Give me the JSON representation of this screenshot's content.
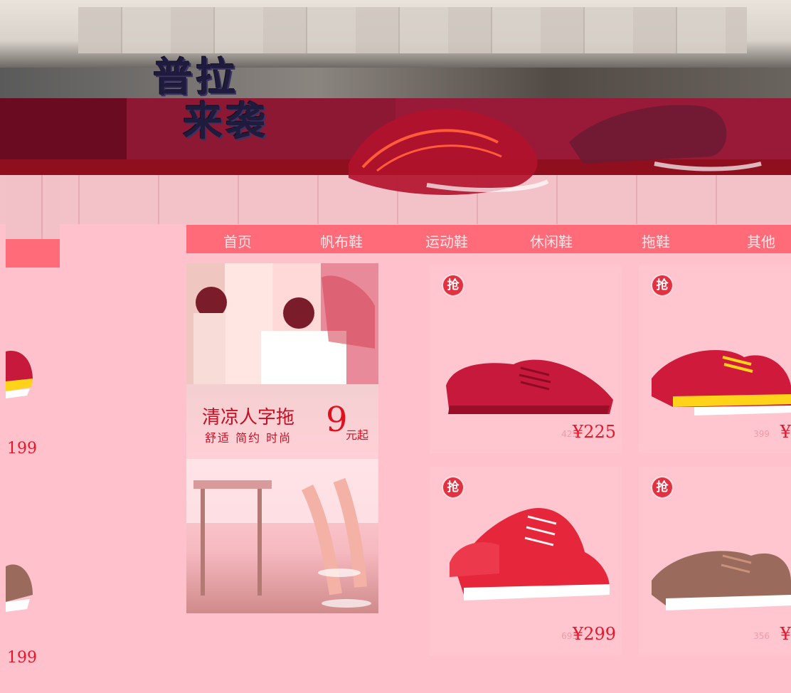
{
  "hero": {
    "title_line1": "普拉",
    "title_line2": "来袭"
  },
  "nav": {
    "items": [
      {
        "label": "首页"
      },
      {
        "label": "帆布鞋"
      },
      {
        "label": "运动鞋"
      },
      {
        "label": "休闲鞋"
      },
      {
        "label": "拖鞋"
      },
      {
        "label": "其他"
      }
    ]
  },
  "promo": {
    "title": "清凉人字拖",
    "subtitle": "舒适 简约 时尚",
    "price_number": "9",
    "price_unit": "元起"
  },
  "left_strip": {
    "prices": [
      "199",
      "199"
    ]
  },
  "products": [
    {
      "badge": "抢",
      "old_price": "425",
      "price": "¥225",
      "shoe_color": "#c7193c",
      "shoe_type": "casual-loafer"
    },
    {
      "badge": "抢",
      "old_price": "399",
      "price": "¥",
      "shoe_color": "#d01a3c",
      "shoe_type": "sport-runner"
    },
    {
      "badge": "抢",
      "old_price": "693",
      "price": "¥299",
      "shoe_color": "#e5263b",
      "shoe_type": "high-top"
    },
    {
      "badge": "抢",
      "old_price": "356",
      "price": "¥",
      "shoe_color": "#9a6b5c",
      "shoe_type": "casual-sneaker"
    }
  ],
  "colors": {
    "nav_bg": "#ff6b78",
    "page_bg": "#ffc2cc",
    "price_red": "#e4182c"
  },
  "icons": {
    "badge_icon": "grab-deal-badge-icon"
  }
}
